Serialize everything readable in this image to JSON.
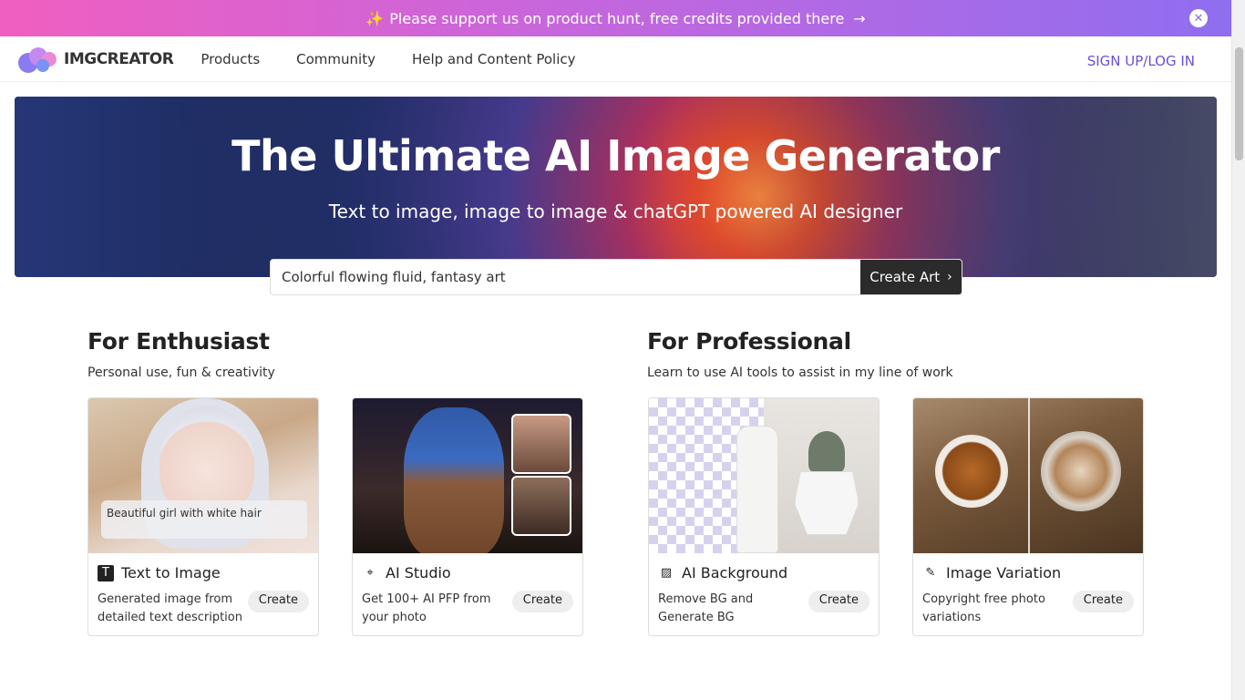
{
  "promo": {
    "text": "Please support us on product hunt, free credits provided there",
    "spark": "✨",
    "arrow": "→",
    "close": "✕"
  },
  "nav": {
    "logo_text": "IMGCREATOR",
    "links": [
      "Products",
      "Community",
      "Help and Content Policy"
    ],
    "signup": "SIGN UP/LOG IN"
  },
  "hero": {
    "title": "The Ultimate AI Image Generator",
    "subtitle": "Text to image, image to image & chatGPT powered AI designer"
  },
  "search": {
    "value": "Colorful flowing fluid, fantasy art",
    "button": "Create Art",
    "chevron": "›"
  },
  "sections": {
    "enthusiast": {
      "title": "For Enthusiast",
      "desc": "Personal use, fun & creativity"
    },
    "professional": {
      "title": "For Professional",
      "desc": "Learn to use AI tools to assist in my line of work"
    }
  },
  "cards": [
    {
      "title": "Text to Image",
      "desc": "Generated image from detailed text description",
      "button": "Create",
      "caption": "Beautiful girl with white hair",
      "icon": "text-icon",
      "glyph": "T"
    },
    {
      "title": "AI Studio",
      "desc": "Get 100+ AI PFP from your photo",
      "button": "Create",
      "icon": "studio-icon",
      "glyph": "⌖"
    },
    {
      "title": "AI Background",
      "desc": "Remove BG and Generate BG",
      "button": "Create",
      "icon": "background-icon",
      "glyph": "▨"
    },
    {
      "title": "Image Variation",
      "desc": "Copyright free photo variations",
      "button": "Create",
      "icon": "edit-icon",
      "glyph": "✎"
    }
  ],
  "colors": {
    "accent": "#6a4fd8",
    "promo_start": "#f05fc0",
    "promo_end": "#8f6ef0",
    "button_dark": "#2b2b2b"
  }
}
